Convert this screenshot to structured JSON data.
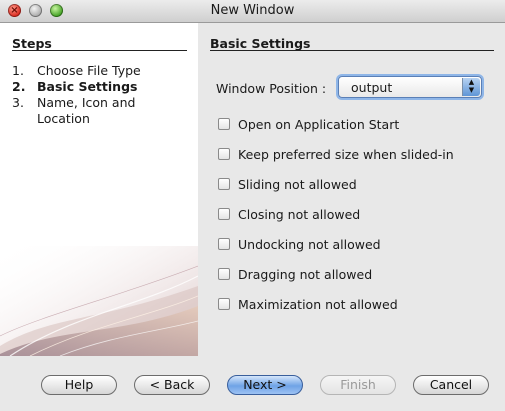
{
  "window": {
    "title": "New Window"
  },
  "steps": {
    "heading": "Steps",
    "items": [
      {
        "num": "1.",
        "label": "Choose File Type"
      },
      {
        "num": "2.",
        "label": "Basic Settings"
      },
      {
        "num": "3.",
        "label": "Name, Icon and Location"
      }
    ],
    "current_index": 1
  },
  "panel": {
    "heading": "Basic Settings",
    "window_position": {
      "label": "Window Position :",
      "value": "output"
    },
    "options": [
      {
        "label": "Open on Application Start",
        "checked": false
      },
      {
        "label": "Keep preferred size when slided-in",
        "checked": false
      },
      {
        "label": "Sliding not allowed",
        "checked": false
      },
      {
        "label": "Closing not allowed",
        "checked": false
      },
      {
        "label": "Undocking not allowed",
        "checked": false
      },
      {
        "label": "Dragging not allowed",
        "checked": false
      },
      {
        "label": "Maximization not allowed",
        "checked": false
      }
    ]
  },
  "buttons": {
    "help": "Help",
    "back": "< Back",
    "next": "Next >",
    "finish": "Finish",
    "cancel": "Cancel"
  },
  "colors": {
    "accent": "#6fa3e6",
    "focus_ring": "#8fb6e8"
  }
}
